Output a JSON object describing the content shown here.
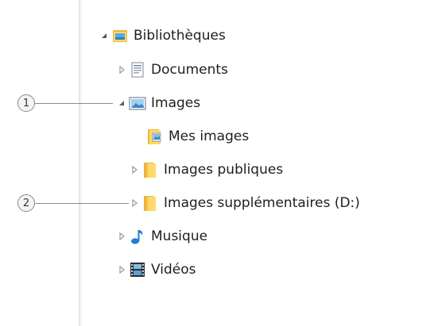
{
  "tree": {
    "libraries": {
      "label": "Bibliothèques",
      "icon": "libraries-icon",
      "expanded": true
    },
    "documents": {
      "label": "Documents",
      "icon": "documents-icon",
      "expanded": false
    },
    "images": {
      "label": "Images",
      "icon": "pictures-library-icon",
      "expanded": true
    },
    "my_images": {
      "label": "Mes images",
      "icon": "pictures-folder-icon"
    },
    "public_images": {
      "label": "Images publiques",
      "icon": "folder-icon",
      "expanded": false
    },
    "extra_images": {
      "label": "Images supplémentaires (D:)",
      "icon": "folder-icon",
      "expanded": false
    },
    "music": {
      "label": "Musique",
      "icon": "music-note-icon",
      "expanded": false
    },
    "videos": {
      "label": "Vidéos",
      "icon": "film-strip-icon",
      "expanded": false
    }
  },
  "callouts": [
    {
      "number": "1"
    },
    {
      "number": "2"
    }
  ],
  "colors": {
    "text": "#1e1e1e",
    "expander": "#595959",
    "collapsed_expander": "#9a9a9a",
    "folder": "#f2c44a",
    "callout_line": "#8a8a8a"
  }
}
